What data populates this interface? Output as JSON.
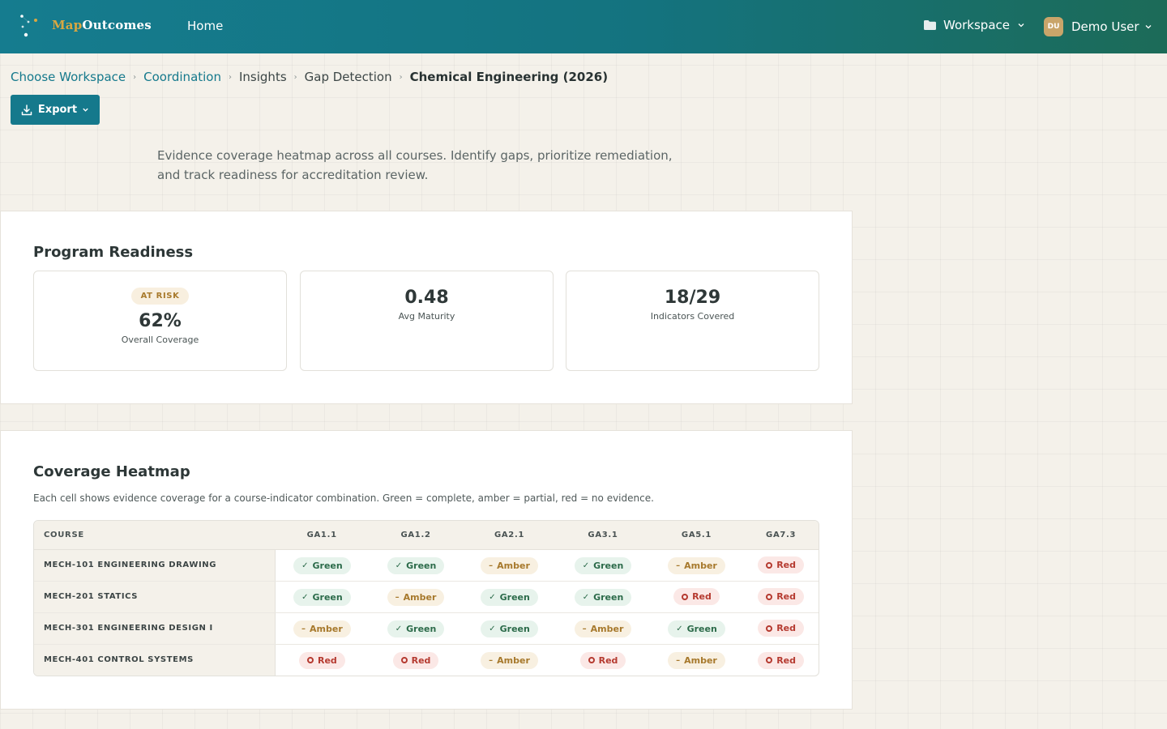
{
  "header": {
    "brand_map": "Map",
    "brand_outcomes": "Outcomes",
    "nav_home": "Home",
    "workspace_label": "Workspace",
    "user_initials": "DU",
    "user_name": "Demo User"
  },
  "breadcrumb": {
    "items": [
      "Choose Workspace",
      "Coordination",
      "Insights",
      "Gap Detection",
      "Chemical Engineering (2026)"
    ]
  },
  "toolbar": {
    "export_label": "Export"
  },
  "description": "Evidence coverage heatmap across all courses. Identify gaps, prioritize remediation, and track readiness for accreditation review.",
  "readiness": {
    "title": "Program Readiness",
    "status_badge": "AT RISK",
    "coverage_value": "62%",
    "coverage_label": "Overall Coverage",
    "maturity_value": "0.48",
    "maturity_label": "Avg Maturity",
    "indicators_value": "18/29",
    "indicators_label": "Indicators Covered"
  },
  "heatmap": {
    "title": "Coverage Heatmap",
    "description": "Each cell shows evidence coverage for a course-indicator combination. Green = complete, amber = partial, red = no evidence.",
    "columns": [
      "COURSE",
      "GA1.1",
      "GA1.2",
      "GA2.1",
      "GA3.1",
      "GA5.1",
      "GA7.3"
    ],
    "rows": [
      {
        "course": "MECH-101 ENGINEERING DRAWING",
        "cells": [
          "Green",
          "Green",
          "Amber",
          "Green",
          "Amber",
          "Red"
        ]
      },
      {
        "course": "MECH-201 STATICS",
        "cells": [
          "Green",
          "Amber",
          "Green",
          "Green",
          "Red",
          "Red"
        ]
      },
      {
        "course": "MECH-301 ENGINEERING DESIGN I",
        "cells": [
          "Amber",
          "Green",
          "Green",
          "Amber",
          "Green",
          "Red"
        ]
      },
      {
        "course": "MECH-401 CONTROL SYSTEMS",
        "cells": [
          "Red",
          "Red",
          "Amber",
          "Red",
          "Amber",
          "Red"
        ]
      }
    ]
  },
  "colors": {
    "header_gradient_start": "#157c8f",
    "header_gradient_end": "#1c6b58",
    "accent": "#15798c",
    "brand_gold": "#d9a741",
    "green": "#2c6b4a",
    "amber": "#a7792c",
    "red": "#b53a30"
  },
  "icons": {
    "logo": "constellation-logo-icon",
    "workspace": "folder-icon",
    "export": "download-icon",
    "dropdown": "chevron-down-icon",
    "complete": "check-icon",
    "partial": "dash-icon",
    "missing": "ring-icon"
  }
}
